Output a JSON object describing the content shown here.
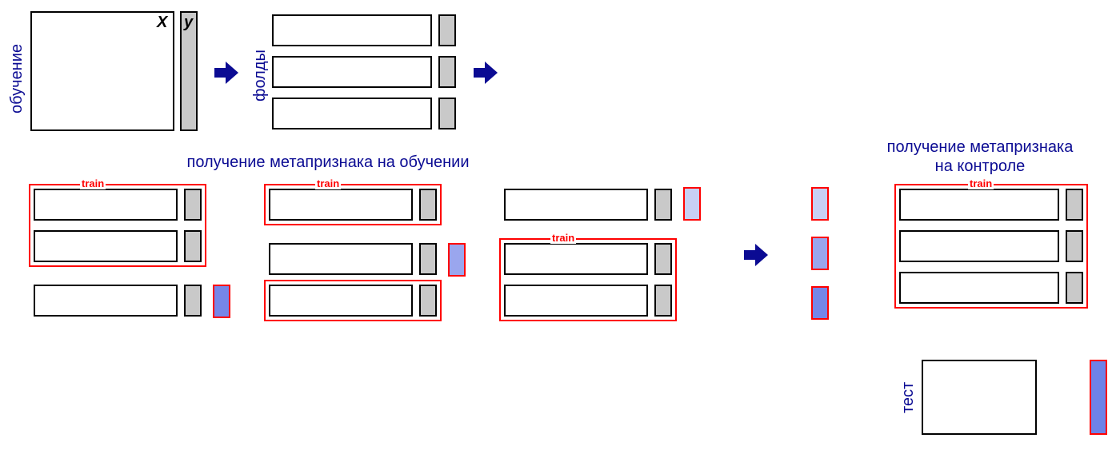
{
  "labels": {
    "training": "обучение",
    "folds": "фолды",
    "test": "тест",
    "train": "train",
    "x": "X",
    "y": "y",
    "meta_on_train": "получение метапризнака на обучении",
    "meta_on_control_l1": "получение метапризнака",
    "meta_on_control_l2": "на контроле",
    "cutoff_partial": ""
  },
  "colors": {
    "pred_light": "#c8d0f4",
    "pred_mid": "#9aa6ee",
    "pred_dark": "#7686e8",
    "test_pred": "#6d82e8"
  }
}
